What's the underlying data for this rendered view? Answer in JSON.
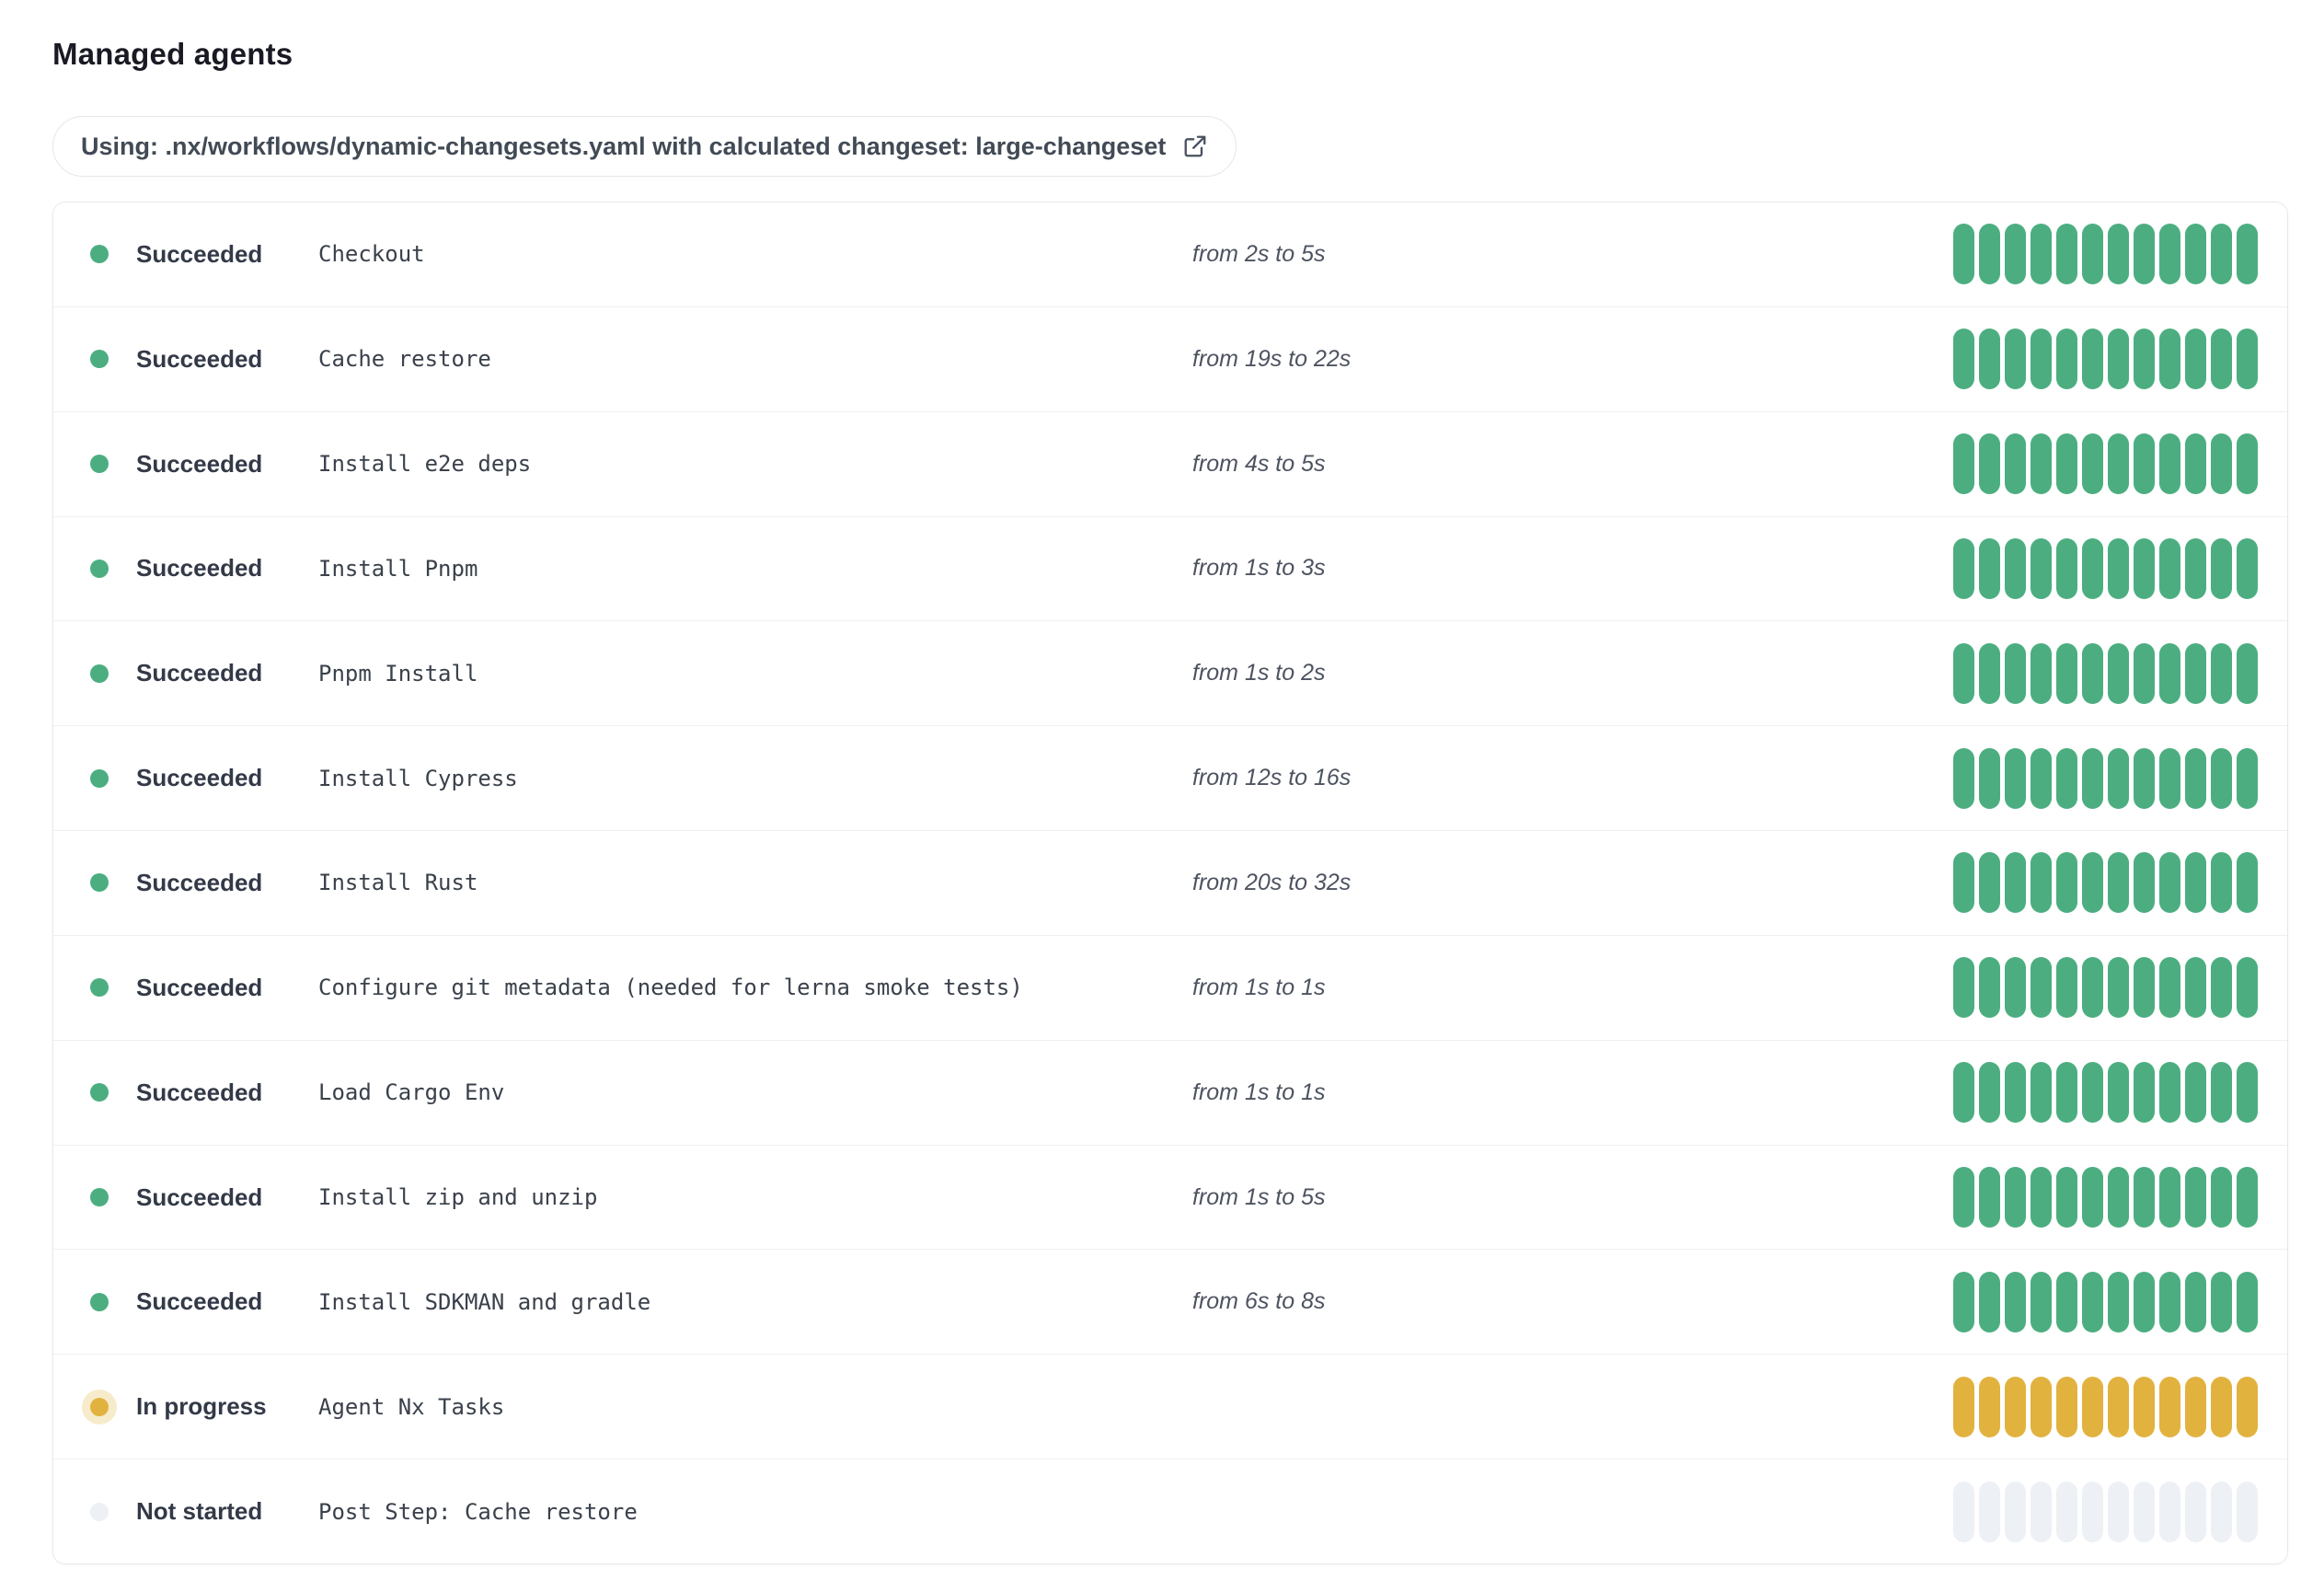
{
  "page": {
    "title": "Managed agents"
  },
  "workflow_banner": {
    "text": "Using: .nx/workflows/dynamic-changesets.yaml with calculated changeset: large-changeset",
    "icon": "external-link-icon"
  },
  "colors": {
    "succeeded": "#4cae80",
    "in_progress": "#e2b23f",
    "in_progress_halo": "#f6eccb",
    "not_started": "#edf0f4",
    "title_text": "#1a1a24",
    "status_text": "#333947",
    "task_text": "#3a414b",
    "duration_text": "#4d5360",
    "card_border": "#e6e8ec",
    "row_divider": "#eef0f3",
    "pill_border": "#e3e6ea",
    "pill_text": "#414a55"
  },
  "agents": {
    "bars_per_row": 12,
    "rows": [
      {
        "status": "Succeeded",
        "status_key": "succeeded",
        "task": "Checkout",
        "duration": "from 2s to 5s"
      },
      {
        "status": "Succeeded",
        "status_key": "succeeded",
        "task": "Cache restore",
        "duration": "from 19s to 22s"
      },
      {
        "status": "Succeeded",
        "status_key": "succeeded",
        "task": "Install e2e deps",
        "duration": "from 4s to 5s"
      },
      {
        "status": "Succeeded",
        "status_key": "succeeded",
        "task": "Install Pnpm",
        "duration": "from 1s to 3s"
      },
      {
        "status": "Succeeded",
        "status_key": "succeeded",
        "task": "Pnpm Install",
        "duration": "from 1s to 2s"
      },
      {
        "status": "Succeeded",
        "status_key": "succeeded",
        "task": "Install Cypress",
        "duration": "from 12s to 16s"
      },
      {
        "status": "Succeeded",
        "status_key": "succeeded",
        "task": "Install Rust",
        "duration": "from 20s to 32s"
      },
      {
        "status": "Succeeded",
        "status_key": "succeeded",
        "task": "Configure git metadata (needed for lerna smoke tests)",
        "duration": "from 1s to 1s"
      },
      {
        "status": "Succeeded",
        "status_key": "succeeded",
        "task": "Load Cargo Env",
        "duration": "from 1s to 1s"
      },
      {
        "status": "Succeeded",
        "status_key": "succeeded",
        "task": "Install zip and unzip",
        "duration": "from 1s to 5s"
      },
      {
        "status": "Succeeded",
        "status_key": "succeeded",
        "task": "Install SDKMAN and gradle",
        "duration": "from 6s to 8s"
      },
      {
        "status": "In progress",
        "status_key": "in_progress",
        "task": "Agent Nx Tasks",
        "duration": ""
      },
      {
        "status": "Not started",
        "status_key": "not_started",
        "task": "Post Step: Cache restore",
        "duration": ""
      }
    ]
  }
}
